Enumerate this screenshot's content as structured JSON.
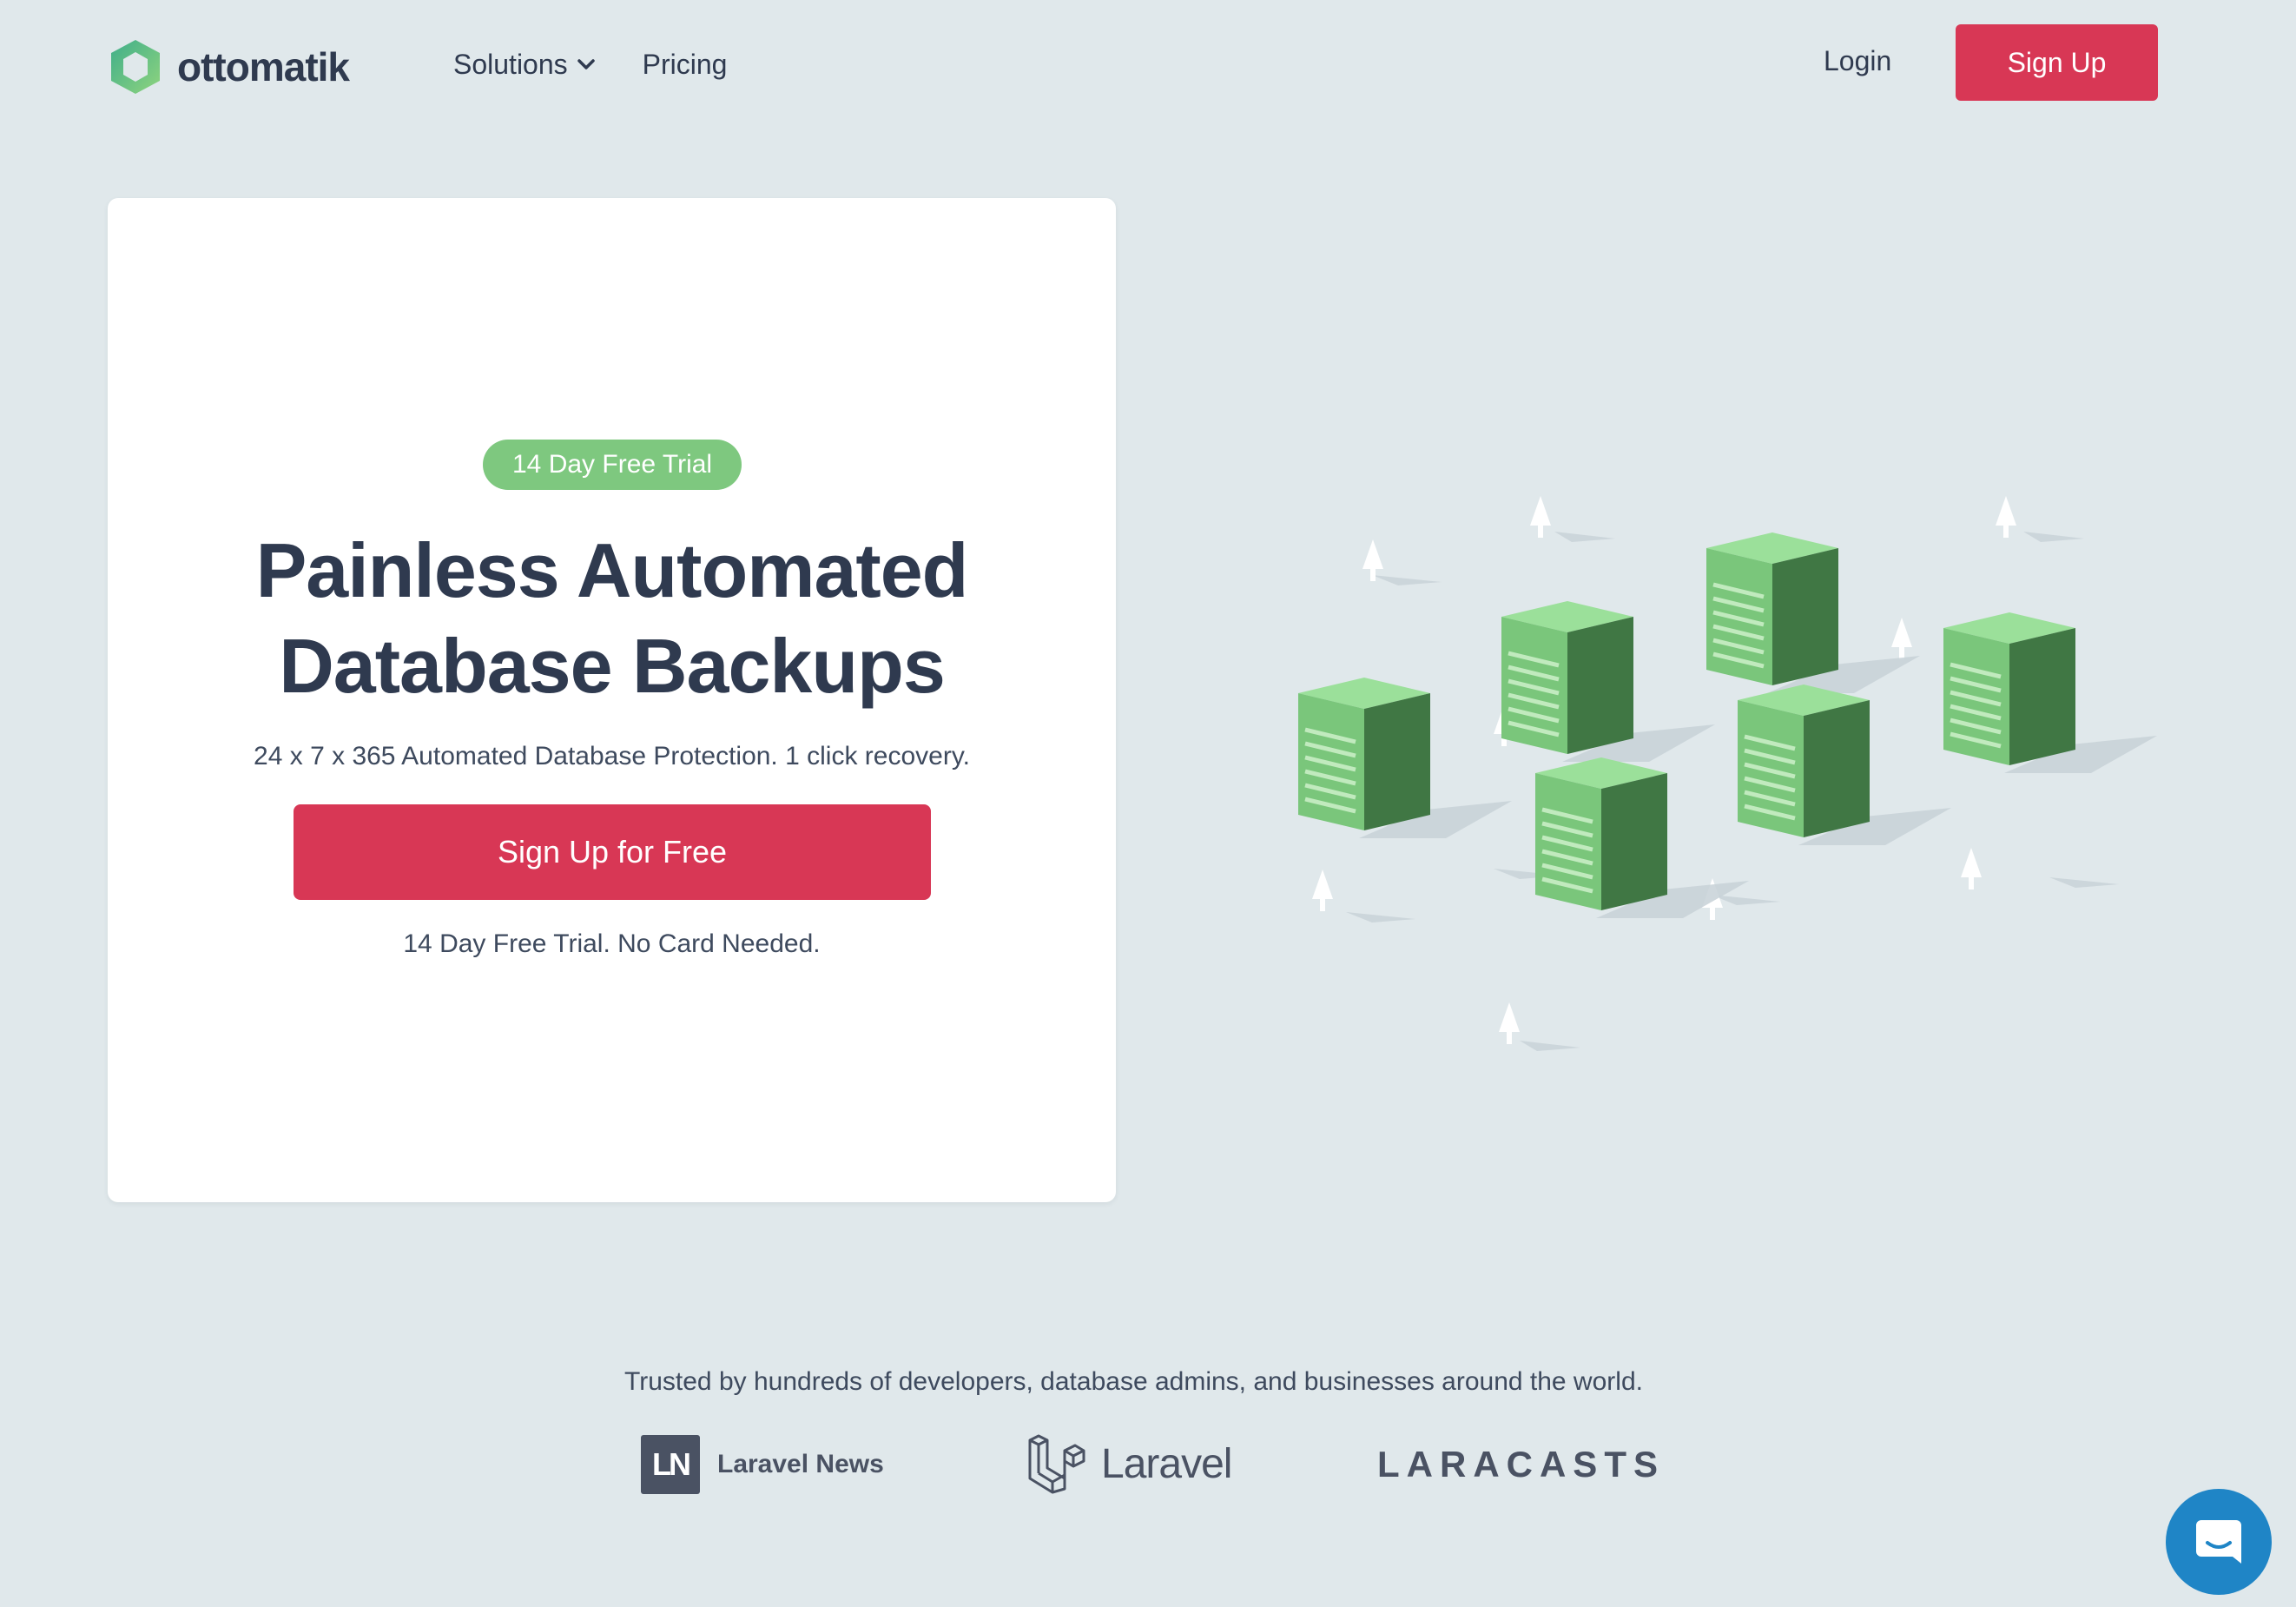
{
  "brand": {
    "name": "ottomatik",
    "logo_icon": "hexagon-ring-icon",
    "colors": {
      "primary_red": "#d83755",
      "green": "#7ec87f",
      "text_dark": "#2f3a4f",
      "background": "#e0e8eb",
      "chat_blue": "#1f85c6"
    }
  },
  "nav": {
    "items": [
      {
        "label": "Solutions",
        "has_dropdown": true
      },
      {
        "label": "Pricing"
      }
    ],
    "login_label": "Login",
    "signup_label": "Sign Up"
  },
  "hero": {
    "badge": "14 Day Free Trial",
    "title_line1": "Painless Automated",
    "title_line2": "Database Backups",
    "subtitle": "24 x 7 x 365 Automated Database Protection. 1 click recovery.",
    "cta_label": "Sign Up for Free",
    "cta_note": "14 Day Free Trial. No Card Needed."
  },
  "trusted": {
    "text": "Trusted by hundreds of developers, database admins, and businesses around the world.",
    "logos": {
      "laravel_news": {
        "mark": "LN",
        "label": "Laravel News"
      },
      "laravel": {
        "label": "Laravel"
      },
      "laracasts": {
        "label": "LARACASTS"
      }
    }
  },
  "chat": {
    "icon": "chat-bubble-icon"
  }
}
